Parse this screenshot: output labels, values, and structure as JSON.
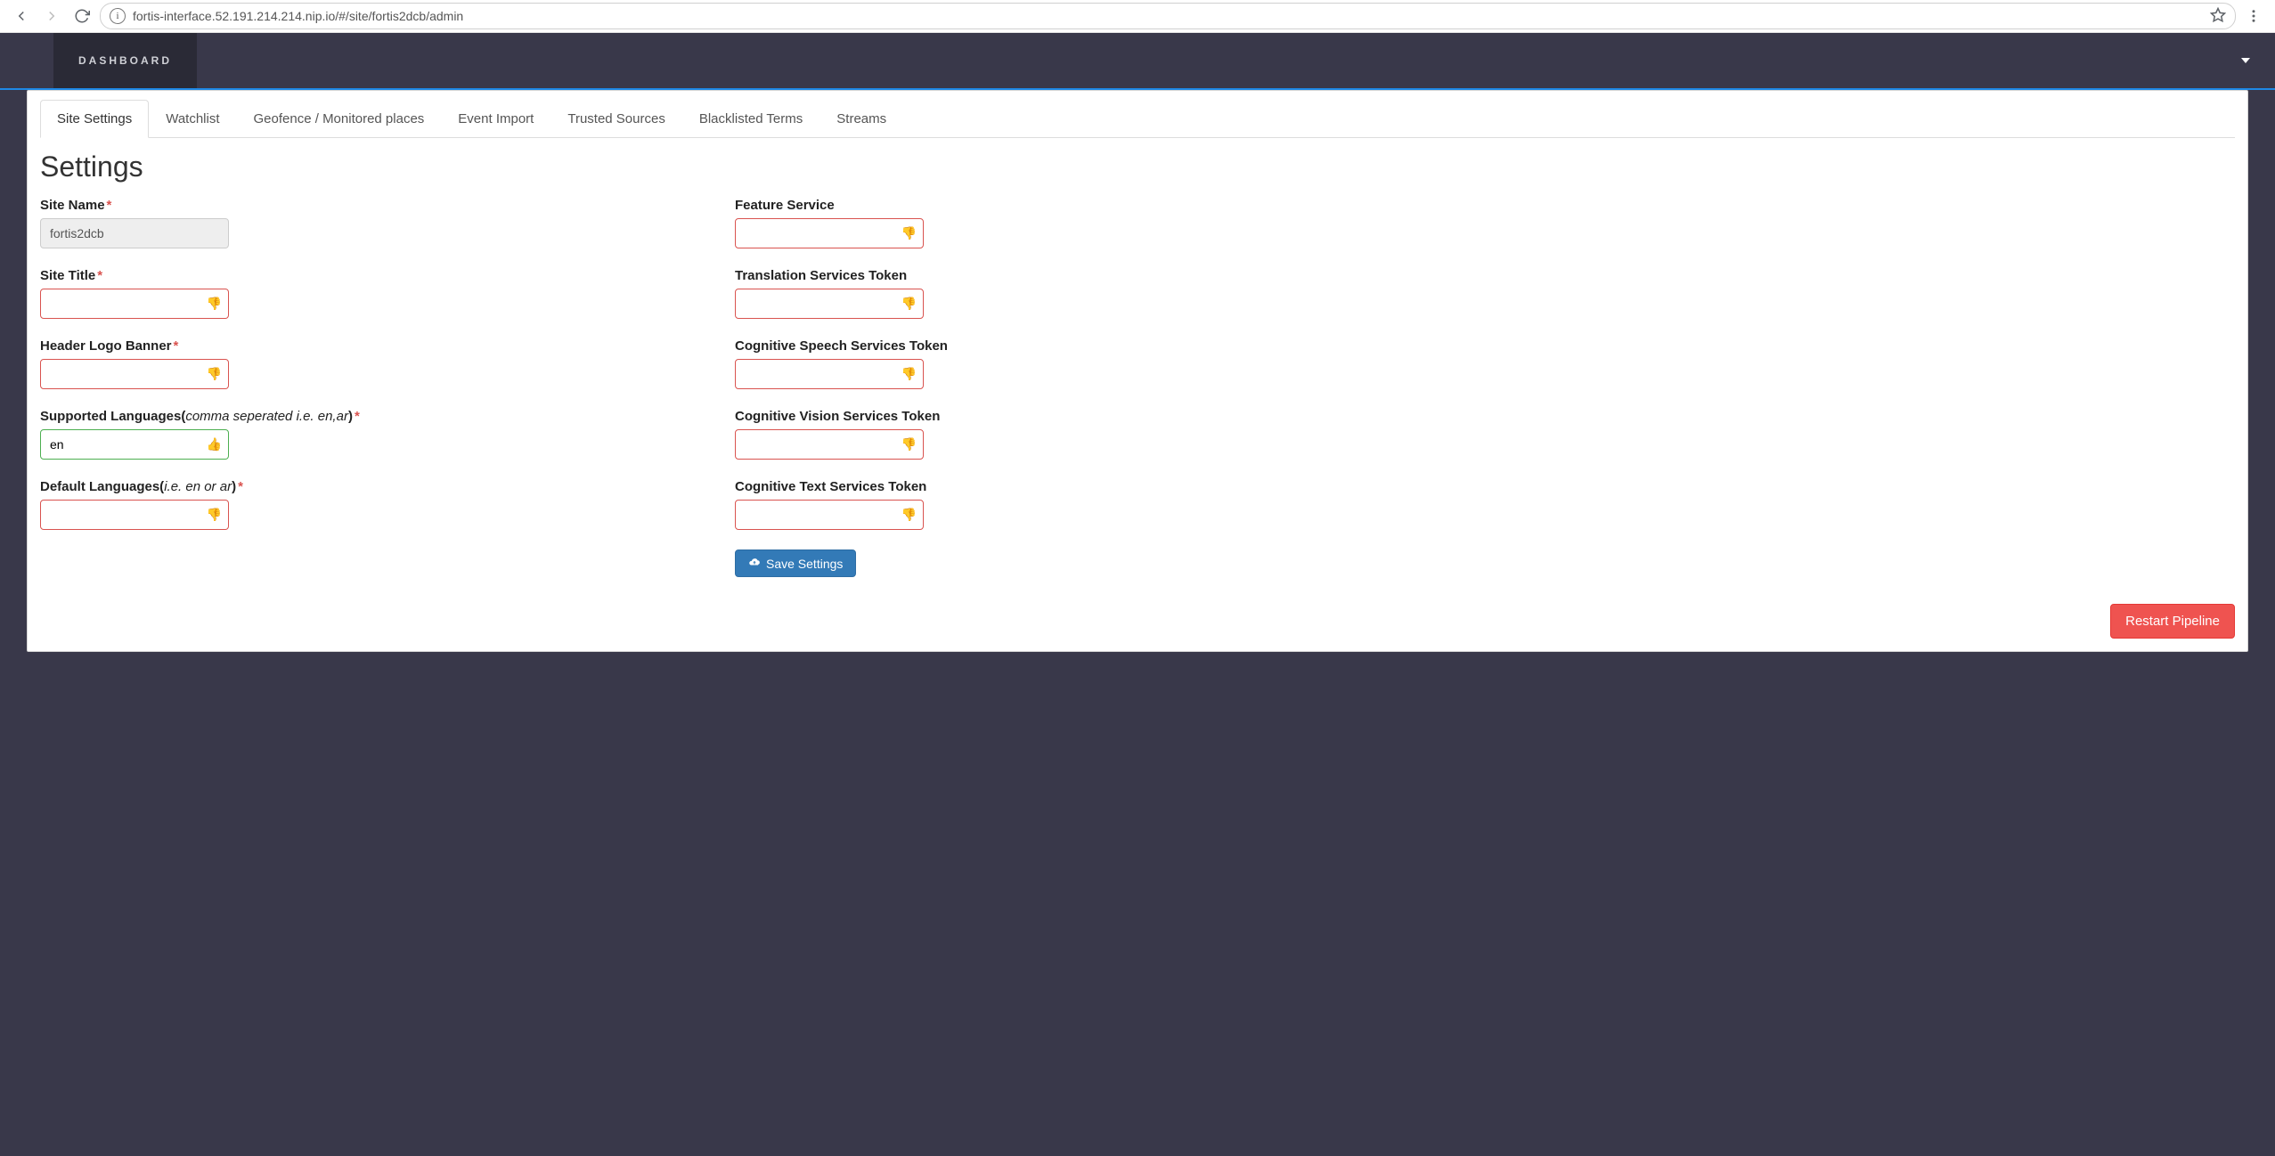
{
  "browser": {
    "url": "fortis-interface.52.191.214.214.nip.io/#/site/fortis2dcb/admin"
  },
  "topbar": {
    "brand": "DASHBOARD"
  },
  "tabs": [
    {
      "label": "Site Settings",
      "active": true
    },
    {
      "label": "Watchlist",
      "active": false
    },
    {
      "label": "Geofence / Monitored places",
      "active": false
    },
    {
      "label": "Event Import",
      "active": false
    },
    {
      "label": "Trusted Sources",
      "active": false
    },
    {
      "label": "Blacklisted Terms",
      "active": false
    },
    {
      "label": "Streams",
      "active": false
    }
  ],
  "page": {
    "title": "Settings"
  },
  "form": {
    "left": {
      "siteName": {
        "label": "Site Name",
        "required": true,
        "value": "fortis2dcb",
        "state": "readonly"
      },
      "siteTitle": {
        "label": "Site Title",
        "required": true,
        "value": "",
        "state": "invalid"
      },
      "headerLogo": {
        "label": "Header Logo Banner",
        "required": true,
        "value": "",
        "state": "invalid"
      },
      "supportedLang": {
        "labelPrefix": "Supported Languages(",
        "hint": "comma seperated i.e. en,ar",
        "labelSuffix": ")",
        "required": true,
        "value": "en",
        "state": "valid"
      },
      "defaultLang": {
        "labelPrefix": "Default Languages(",
        "hint": "i.e. en or ar",
        "labelSuffix": ")",
        "required": true,
        "value": "",
        "state": "invalid"
      }
    },
    "right": {
      "featureService": {
        "label": "Feature Service",
        "state": "invalid"
      },
      "translationToken": {
        "label": "Translation Services Token",
        "state": "invalid"
      },
      "speechToken": {
        "label": "Cognitive Speech Services Token",
        "state": "invalid"
      },
      "visionToken": {
        "label": "Cognitive Vision Services Token",
        "state": "invalid"
      },
      "textToken": {
        "label": "Cognitive Text Services Token",
        "state": "invalid"
      }
    },
    "saveLabel": "Save Settings",
    "restartLabel": "Restart Pipeline"
  }
}
